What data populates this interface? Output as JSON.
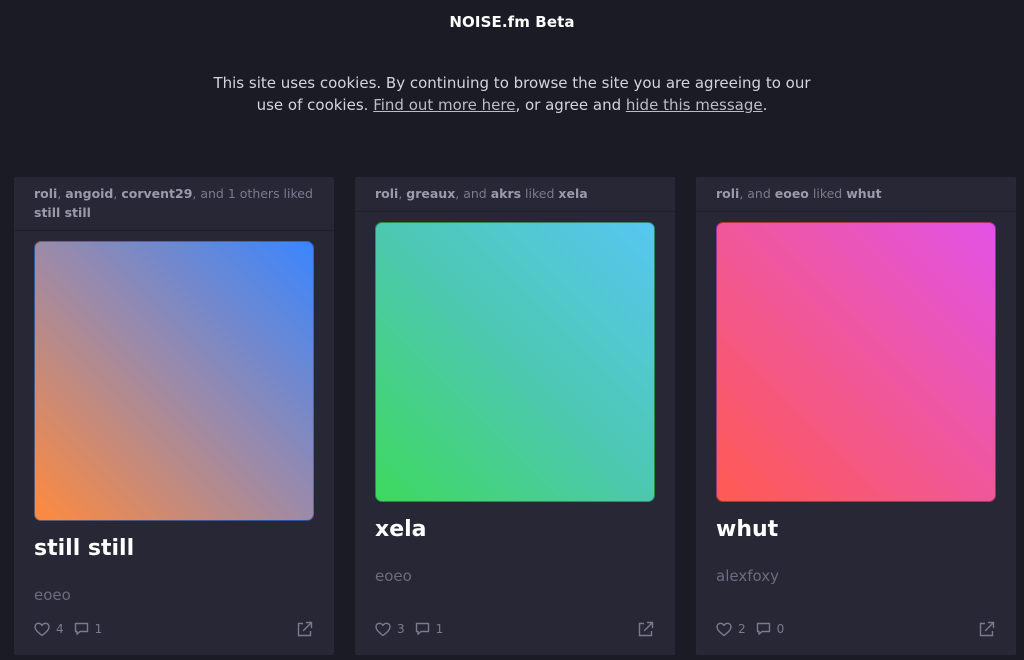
{
  "header": {
    "brand": "NOISE.fm Beta"
  },
  "cookie_banner": {
    "text_before": "This site uses cookies. By continuing to browse the site you are agreeing to our use of cookies. ",
    "link_more": "Find out more here",
    "text_middle": ", or agree and ",
    "link_hide": "hide this message",
    "text_after": "."
  },
  "cards": [
    {
      "liked_users": [
        "roli",
        "angoid",
        "corvent29"
      ],
      "liked_suffix": ", and 1 others liked",
      "liked_track": "still still",
      "title": "still still",
      "artist": "eoeo",
      "likes": "4",
      "comments": "1",
      "gradient": [
        "#ff8a3d",
        "#9c8aa8",
        "#3a86ff"
      ]
    },
    {
      "liked_users": [
        "roli",
        "greaux"
      ],
      "liked_and_user": "akrs",
      "liked_suffix": " liked",
      "liked_track": "xela",
      "title": "xela",
      "artist": "eoeo",
      "likes": "3",
      "comments": "1",
      "gradient": [
        "#3ed95f",
        "#4dc8b0",
        "#57c7f2"
      ]
    },
    {
      "liked_users": [
        "roli"
      ],
      "liked_and_user": "eoeo",
      "liked_suffix": " liked",
      "liked_track": "whut",
      "title": "whut",
      "artist": "alexfoxy",
      "likes": "2",
      "comments": "0",
      "gradient": [
        "#ff5a52",
        "#f0579a",
        "#e252e6"
      ]
    }
  ],
  "labels": {
    "sep": ", ",
    "and": ", and "
  },
  "icons": {
    "like": "heart-icon",
    "comment": "comment-icon",
    "share": "share-icon"
  }
}
